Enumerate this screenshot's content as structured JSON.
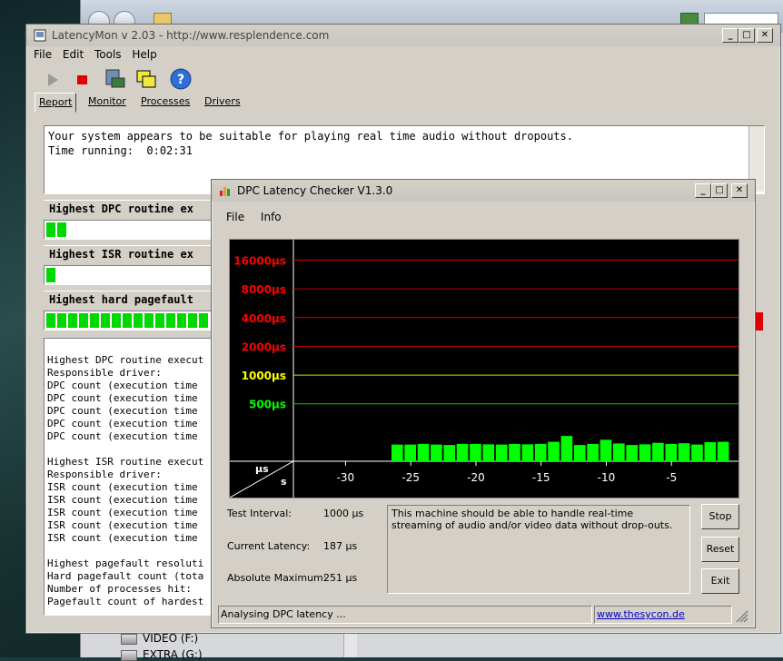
{
  "latencymon": {
    "title": "LatencyMon v 2.03 - http://www.resplendence.com",
    "menu": [
      "File",
      "Edit",
      "Tools",
      "Help"
    ],
    "tabs": [
      "Report",
      "Monitor",
      "Processes",
      "Drivers"
    ],
    "summary_line1": "Your system appears to be suitable for playing real time audio without dropouts.",
    "summary_line2": "Time running:  0:02:31",
    "section_dpc": "Highest DPC routine ex",
    "section_isr": "Highest ISR routine ex",
    "section_pf": "Highest hard pagefault",
    "dpc_segments": 2,
    "isr_segments": 1,
    "pf_segments": 15,
    "log_lines": [
      "Highest DPC routine execut",
      "Responsible driver:",
      "DPC count (execution time",
      "DPC count (execution time",
      "DPC count (execution time",
      "DPC count (execution time",
      "DPC count (execution time",
      "",
      "Highest ISR routine execut",
      "Responsible driver:",
      "ISR count (execution time",
      "ISR count (execution time",
      "ISR count (execution time",
      "ISR count (execution time",
      "ISR count (execution time",
      "",
      "Highest pagefault resoluti",
      "Hard pagefault count (tota",
      "Number of processes hit:",
      "Pagefault count of hardest"
    ]
  },
  "dpc_checker": {
    "title": "DPC Latency Checker V1.3.0",
    "menu": [
      "File",
      "Info"
    ],
    "test_interval_label": "Test Interval:",
    "test_interval_value": "1000 µs",
    "current_latency_label": "Current Latency:",
    "current_latency_value": "187 µs",
    "absolute_max_label": "Absolute Maximum:",
    "absolute_max_value": "251 µs",
    "message": "This machine should be able to handle real-time streaming of audio and/or video data without drop-outs.",
    "stop_label": "Stop",
    "reset_label": "Reset",
    "exit_label": "Exit",
    "status": "Analysing DPC latency ...",
    "link": "www.thesycon.de",
    "axis_unit_y": "µs",
    "axis_unit_x": "s"
  },
  "explorer": {
    "drives": [
      "VIDEO (F:)",
      "EXTRA (G:)"
    ]
  },
  "chart_data": {
    "type": "bar",
    "xlabel": "s",
    "ylabel": "µs",
    "x_ticks": [
      "-30",
      "-25",
      "-20",
      "-15",
      "-10",
      "-5"
    ],
    "xlim": [
      -34,
      0
    ],
    "y_ticks": [
      "500µs",
      "1000µs",
      "2000µs",
      "4000µs",
      "8000µs",
      "16000µs"
    ],
    "y_tick_colors": [
      "#00ff00",
      "#ffff00",
      "#ff0000",
      "#ff0000",
      "#ff0000",
      "#ff0000"
    ],
    "y_scale": "log",
    "x": [
      -26,
      -25,
      -24,
      -23,
      -22,
      -21,
      -20,
      -19,
      -18,
      -17,
      -16,
      -15,
      -14,
      -13,
      -12,
      -11,
      -10,
      -9,
      -8,
      -7,
      -6,
      -5,
      -4,
      -3,
      -2,
      -1
    ],
    "values": [
      187,
      187,
      190,
      187,
      185,
      190,
      190,
      188,
      187,
      190,
      188,
      190,
      200,
      230,
      185,
      190,
      210,
      192,
      185,
      188,
      195,
      190,
      193,
      187,
      198,
      200
    ],
    "bar_color": "#00ff00"
  }
}
